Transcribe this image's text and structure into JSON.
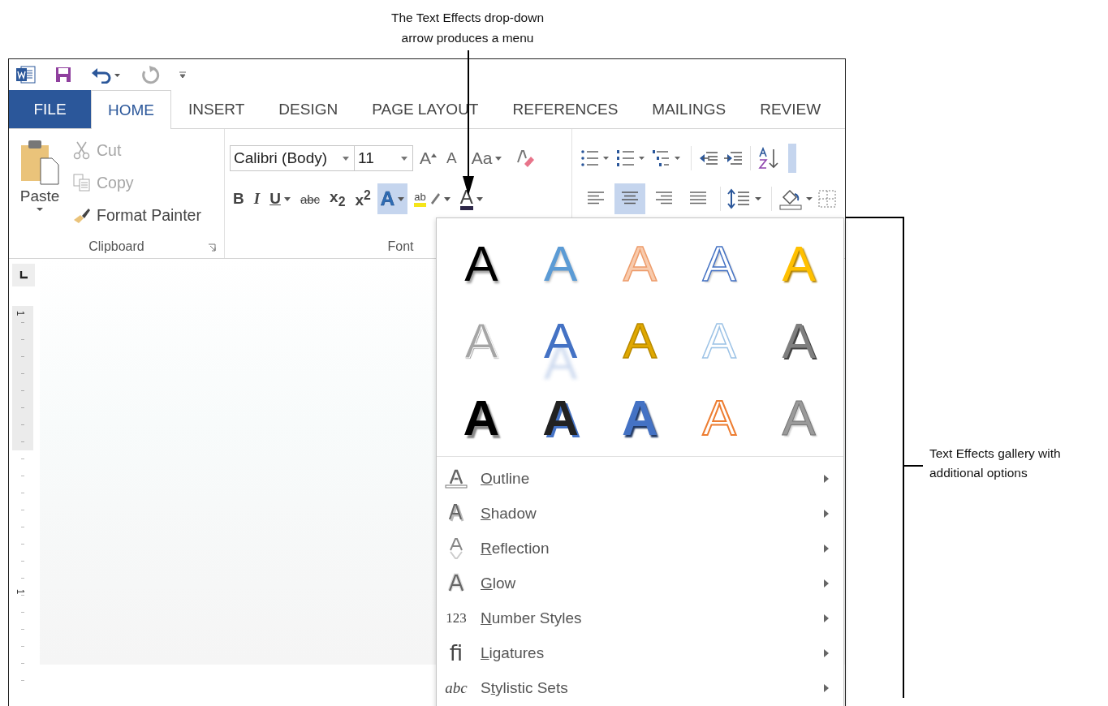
{
  "callouts": {
    "top_lines": [
      "The Text Effects drop-down",
      "arrow produces a menu"
    ],
    "right_lines": [
      "Text Effects gallery with",
      "additional options"
    ]
  },
  "tabs": [
    {
      "label": "FILE",
      "kind": "file",
      "selected": false
    },
    {
      "label": "HOME",
      "kind": "tab",
      "selected": true
    },
    {
      "label": "INSERT",
      "kind": "tab",
      "selected": false
    },
    {
      "label": "DESIGN",
      "kind": "tab",
      "selected": false
    },
    {
      "label": "PAGE LAYOUT",
      "kind": "tab",
      "selected": false
    },
    {
      "label": "REFERENCES",
      "kind": "tab",
      "selected": false
    },
    {
      "label": "MAILINGS",
      "kind": "tab",
      "selected": false
    },
    {
      "label": "REVIEW",
      "kind": "tab",
      "selected": false
    }
  ],
  "ribbon": {
    "clipboard": {
      "paste": {
        "label": "Paste"
      },
      "commands": [
        {
          "kind": "cut",
          "label": "Cut",
          "disabled": true
        },
        {
          "kind": "copy",
          "label": "Copy",
          "disabled": true
        },
        {
          "kind": "painter",
          "label": "Format Painter",
          "disabled": false
        }
      ],
      "label": "Clipboard"
    },
    "font": {
      "font_name": "Calibri (Body)",
      "font_size": "11",
      "size_tools": [
        {
          "kind": "grow",
          "glyph": "A"
        },
        {
          "kind": "shrink",
          "glyph": "A"
        },
        {
          "kind": "case",
          "glyph": "Aa"
        },
        {
          "kind": "clear"
        }
      ],
      "format_tools": [
        {
          "kind": "bold",
          "glyph": "B",
          "expanded": false
        },
        {
          "kind": "italic",
          "glyph": "I",
          "expanded": false
        },
        {
          "kind": "underline",
          "glyph": "U",
          "expanded": false
        },
        {
          "kind": "strike",
          "glyph": "abc",
          "expanded": false
        },
        {
          "kind": "sub",
          "glyph": "x$_{2}$",
          "expanded": false
        },
        {
          "kind": "sup",
          "glyph": "x$^{2}$",
          "expanded": false
        },
        {
          "kind": "effects",
          "glyph": "A",
          "expanded": true
        },
        {
          "kind": "highlight",
          "glyph": "ab",
          "expanded": false
        },
        {
          "kind": "color",
          "glyph": "A",
          "expanded": false
        }
      ],
      "label": "Font"
    },
    "paragraph": {
      "alignment": [
        {
          "kind": "left",
          "selected": false
        },
        {
          "kind": "center",
          "selected": true
        },
        {
          "kind": "right",
          "selected": false
        },
        {
          "kind": "justify",
          "selected": false
        }
      ]
    }
  },
  "ruler": {
    "numbers": [
      "1",
      "1"
    ]
  },
  "text_effects_menu": {
    "gallery": [
      {
        "kind": "black",
        "letter": "A"
      },
      {
        "kind": "blue",
        "letter": "A"
      },
      {
        "kind": "peach",
        "letter": "A"
      },
      {
        "kind": "outline",
        "letter": "A"
      },
      {
        "kind": "gold",
        "letter": "A"
      },
      {
        "kind": "grey",
        "letter": "A"
      },
      {
        "kind": "reflect",
        "letter": "A"
      },
      {
        "kind": "yellow",
        "letter": "A"
      },
      {
        "kind": "pale",
        "letter": "A"
      },
      {
        "kind": "bevel",
        "letter": "A"
      },
      {
        "kind": "heavy",
        "letter": "A"
      },
      {
        "kind": "blueshadow",
        "letter": "A"
      },
      {
        "kind": "blueglow",
        "letter": "A"
      },
      {
        "kind": "orange",
        "letter": "A"
      },
      {
        "kind": "silver",
        "letter": "A"
      }
    ],
    "items": [
      {
        "kind": "outline",
        "key": "O",
        "post": "utline"
      },
      {
        "kind": "shadow",
        "key": "S",
        "post": "hadow"
      },
      {
        "kind": "reflection",
        "key": "R",
        "post": "eflection"
      },
      {
        "kind": "glow",
        "key": "G",
        "post": "low"
      },
      {
        "kind": "glyph",
        "glyph": "123",
        "key": "N",
        "post": "umber Styles"
      },
      {
        "kind": "glyph",
        "glyph": "ﬁ",
        "key": "L",
        "post": "igatures"
      },
      {
        "kind": "glyph",
        "glyph": "abc",
        "pre": "S",
        "key": "t",
        "post": "ylistic Sets"
      }
    ]
  }
}
